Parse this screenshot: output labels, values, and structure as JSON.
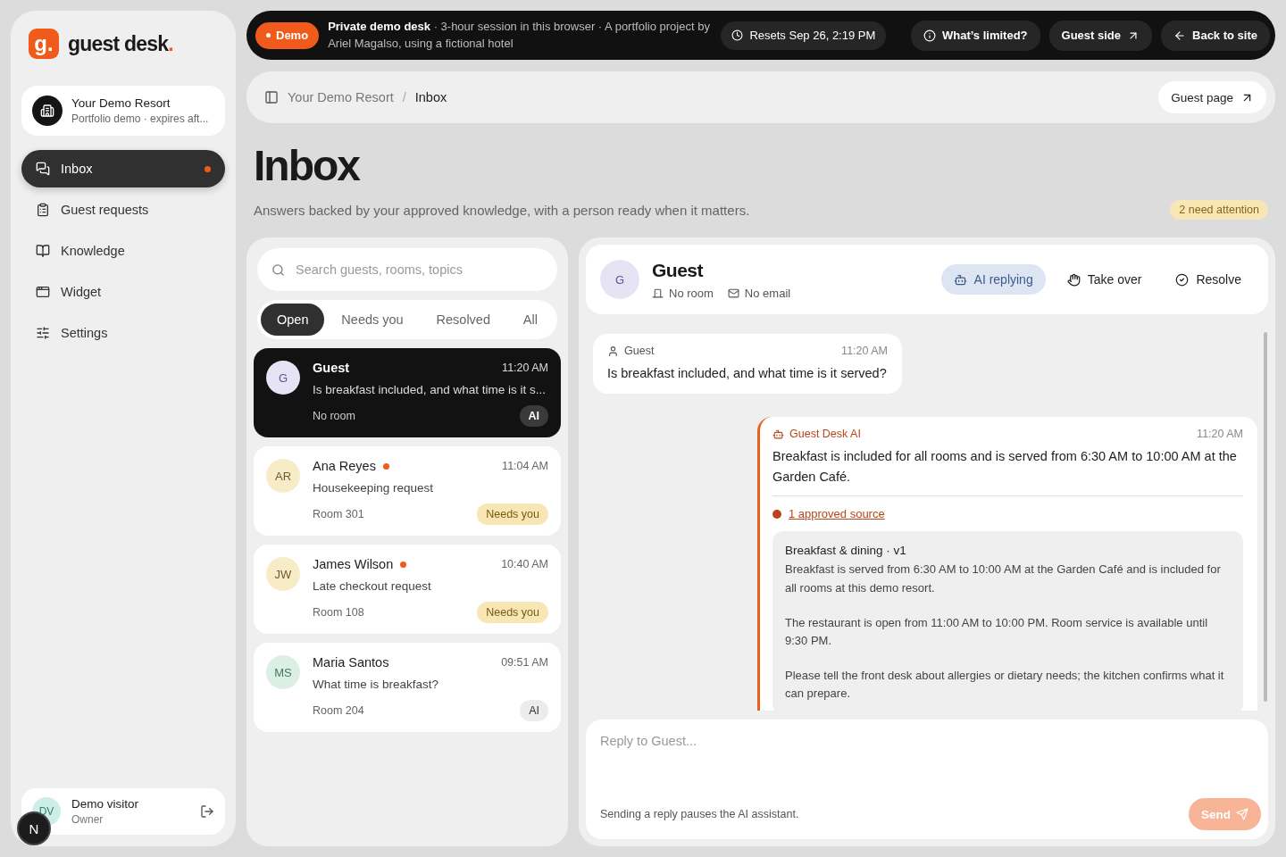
{
  "brand": {
    "mark": "g.",
    "name": "guest desk",
    "accent": "."
  },
  "property": {
    "name": "Your Demo Resort",
    "subtitle": "Portfolio demo · expires aft..."
  },
  "nav": [
    {
      "kind": "inbox",
      "label": "Inbox",
      "selected": true,
      "unread": true
    },
    {
      "kind": "requests",
      "label": "Guest requests",
      "selected": false,
      "unread": false
    },
    {
      "kind": "knowledge",
      "label": "Knowledge",
      "selected": false,
      "unread": false
    },
    {
      "kind": "widget",
      "label": "Widget",
      "selected": false,
      "unread": false
    },
    {
      "kind": "settings",
      "label": "Settings",
      "selected": false,
      "unread": false
    }
  ],
  "user": {
    "initials": "DV",
    "name": "Demo visitor",
    "role": "Owner"
  },
  "dev_badge": "N",
  "banner": {
    "badge": "Demo",
    "text": "**Private demo desk** · 3-hour session in this browser · A portfolio project by Ariel Magalso, using a fictional hotel",
    "reset": "Resets Sep 26, 2:19 PM",
    "actions": [
      {
        "kind": "info",
        "label": "What’s limited?"
      },
      {
        "kind": "external",
        "label": "Guest side"
      },
      {
        "kind": "back",
        "label": "Back to site"
      }
    ]
  },
  "breadcrumb": {
    "items": [
      "Your Demo Resort",
      "Inbox"
    ],
    "separator": "/",
    "action": "Guest page"
  },
  "page": {
    "title": "Inbox",
    "subtitle": "Answers backed by your approved knowledge, with a person ready when it matters.",
    "attention": "2 need attention"
  },
  "search": {
    "placeholder": "Search guests, rooms, topics"
  },
  "filters": [
    {
      "label": "Open",
      "selected": true
    },
    {
      "label": "Needs you",
      "selected": false
    },
    {
      "label": "Resolved",
      "selected": false
    },
    {
      "label": "All",
      "selected": false
    }
  ],
  "conversations": [
    {
      "initials": "G",
      "name": "Guest",
      "time": "11:20 AM",
      "preview": "Is breakfast included, and what time is it s...",
      "room": "No room",
      "tag": {
        "kind": "ai",
        "label": "AI"
      },
      "unread": false,
      "selected": true,
      "color": "#e6e3f5"
    },
    {
      "initials": "AR",
      "name": "Ana Reyes",
      "time": "11:04 AM",
      "preview": "Housekeeping request",
      "room": "Room 301",
      "tag": {
        "kind": "needs",
        "label": "Needs you"
      },
      "unread": true,
      "selected": false,
      "color": "#f8ebc8"
    },
    {
      "initials": "JW",
      "name": "James Wilson",
      "time": "10:40 AM",
      "preview": "Late checkout request",
      "room": "Room 108",
      "tag": {
        "kind": "needs",
        "label": "Needs you"
      },
      "unread": true,
      "selected": false,
      "color": "#f8ebc8"
    },
    {
      "initials": "MS",
      "name": "Maria Santos",
      "time": "09:51 AM",
      "preview": "What time is breakfast?",
      "room": "Room 204",
      "tag": {
        "kind": "ai",
        "label": "AI"
      },
      "unread": false,
      "selected": false,
      "color": "#dcefe4"
    }
  ],
  "conversation": {
    "initials": "G",
    "name": "Guest",
    "room": "No room",
    "email": "No email",
    "actions": [
      {
        "kind": "status",
        "label": "AI replying",
        "selected": true
      },
      {
        "kind": "takeover",
        "label": "Take over",
        "selected": false
      },
      {
        "kind": "resolve",
        "label": "Resolve",
        "selected": false
      }
    ],
    "messages": [
      {
        "kind": "guest",
        "author": "Guest",
        "time": "11:20 AM",
        "text": "Is breakfast included, and what time is it served?"
      },
      {
        "kind": "ai",
        "author": "Guest Desk AI",
        "time": "11:20 AM",
        "text": "Breakfast is included for all rooms and is served from 6:30 AM to 10:00 AM at the Garden Café.",
        "source_link": "1 approved source",
        "source": {
          "title": "Breakfast & dining · v1",
          "paragraphs": [
            "Breakfast is served from 6:30 AM to 10:00 AM at the Garden Café and is included for all rooms at this demo resort.",
            "The restaurant is open from 11:00 AM to 10:00 PM. Room service is available until 9:30 PM.",
            "Please tell the front desk about allergies or dietary needs; the kitchen confirms what it can prepare."
          ]
        }
      }
    ]
  },
  "composer": {
    "placeholder": "Reply to Guest...",
    "hint": "Sending a reply pauses the AI assistant.",
    "send": "Send"
  }
}
